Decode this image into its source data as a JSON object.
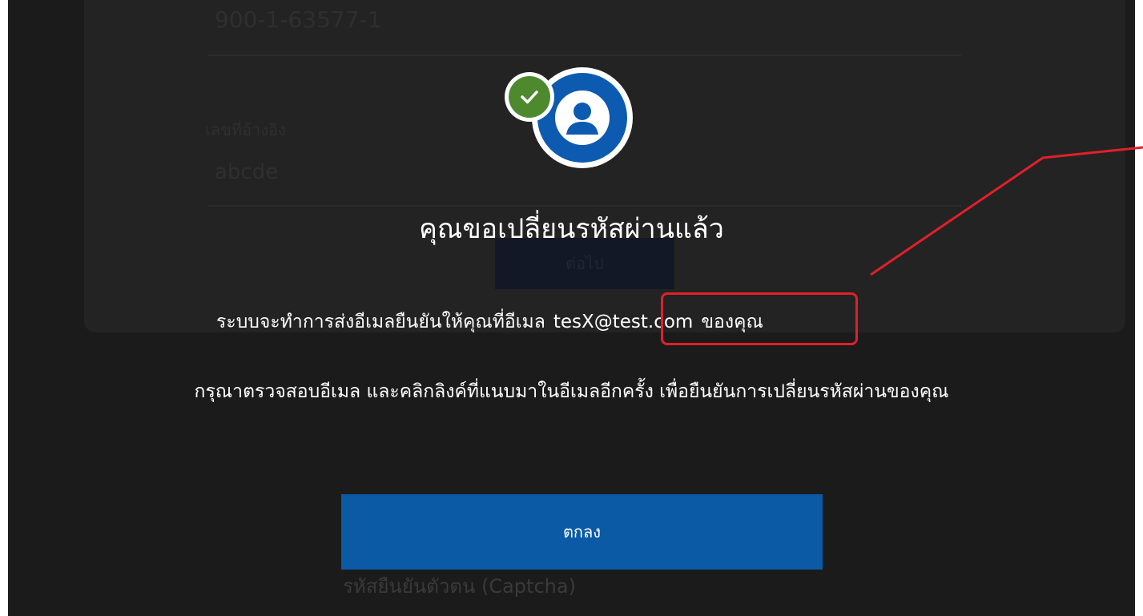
{
  "background_form": {
    "account_number": "900-1-63577-1",
    "reference_label": "เลขที่อ้างอิง",
    "reference_value": "abcde",
    "next_button": "ต่อไป",
    "captcha_label": "รหัสยืนยันตัวตน (Captcha)"
  },
  "modal": {
    "title": "คุณขอเปลี่ยนรหัสผ่านแล้ว",
    "message_prefix": "ระบบจะทำการส่งอีเมลยืนยันให้คุณที่อีเมล",
    "email": "tesX@test.com",
    "message_suffix": "ของคุณ",
    "instruction": "กรุณาตรวจสอบอีเมล และคลิกลิงค์ที่แนบมาในอีเมลอีกครั้ง เพื่อยืนยันการเปลี่ยนรหัสผ่านของคุณ",
    "ok_button": "ตกลง",
    "icons": {
      "avatar": "user-avatar-icon",
      "badge": "check-badge-icon"
    }
  },
  "colors": {
    "overlay": "#1b1b1b",
    "primary_button": "#0b5aa6",
    "avatar_blue": "#0d5bb0",
    "check_green": "#4d8a2e",
    "annotation_red": "#e0202a"
  }
}
